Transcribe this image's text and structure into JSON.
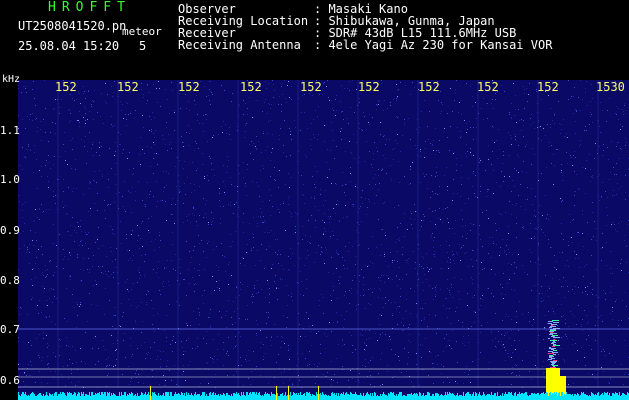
{
  "header": {
    "app_title": "HROFFT",
    "file_name": "UT2508041520.pn",
    "file_tag": "meteor",
    "date_time": "25.08.04 15:20",
    "count": "5",
    "fields": [
      {
        "key": "Observer",
        "value": ": Masaki Kano"
      },
      {
        "key": "Receiving Location",
        "value": ": Shibukawa, Gunma, Japan"
      },
      {
        "key": "Receiver",
        "value": ": SDR# 43dB L15 111.6MHz USB"
      },
      {
        "key": "Receiving Antenna",
        "value": ": 4ele Yagi Az 230 for Kansai VOR"
      }
    ]
  },
  "axes": {
    "y_unit": "kHz",
    "y_ticks": [
      "1.1",
      "1.0",
      "0.9",
      "0.8",
      "0.7",
      "0.6"
    ],
    "x_ticks": [
      "152",
      "152",
      "152",
      "152",
      "152",
      "152",
      "152",
      "152",
      "152",
      "152",
      "1530"
    ]
  },
  "colors": {
    "background": "#0a0a66",
    "noise": "#3a46c8",
    "baseline_trace": "#00e5ff",
    "meteor_echo": "#ffff00",
    "header_title": "#33ff33",
    "tick_label": "#ffff66"
  }
}
